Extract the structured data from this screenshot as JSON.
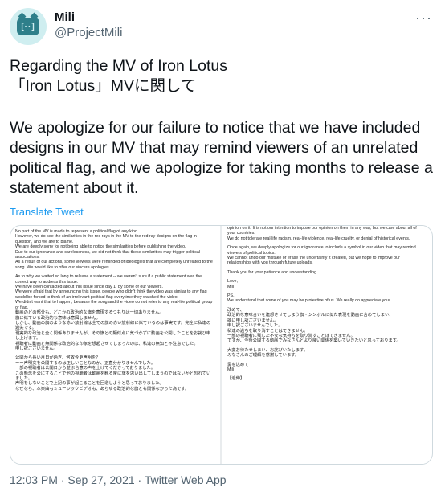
{
  "author": {
    "display_name": "Mili",
    "handle": "@ProjectMili"
  },
  "tweet": {
    "line1": "Regarding the MV of Iron Lotus",
    "line2": "「Iron Lotus」MVに関して",
    "line3": "We apologize for our failure to notice that we have included designs in our MV that may remind viewers of an unrelated political flag, and we apologize for taking months to release a statement about it.",
    "translate": "Translate Tweet",
    "timestamp": "12:03 PM · Sep 27, 2021 · Twitter Web App"
  },
  "attachment": {
    "left": [
      "No part of the MV is made to represent a political flag of any kind.\nHowever, we do see the similarities in the red rays in the MV to the red ray designs on the flag in question, and we are to blame.\nWe are deeply sorry for not being able to notice the similarities before publishing the video.\nDue to our ignorance and carelessness, we did not think that these similarities may trigger political associations.\nAs a result of our actions, some viewers were reminded of ideologies that are completely unrelated to the song. We would like to offer our sincere apologies.",
      "As to why we waited so long to release a statement -- we weren't sure if a public statement was the correct way to address this issue.\nWe have been contacted about this issue since day 1, by some of our viewers.\nWe were afraid that by announcing this issue, people who didn't think the video was similar to any flag would be forced to think of an irrelevant political flag everytime they watched the video.\nWe didn't want that to happen, because the song and the video do not refer to any real-life political group or flag.\n動画のどの部分も、どこかの政治的な旗を表現するつもりは一切ありません。\n旗に似ている政治的な意味は意図しません。\nしかし、動画の旗のような赤い放射線は全ての旗の赤い放射線に似ているのは事実です。完全に私達の過失です。\n現実的な政治と全く関係ありませんが、その旗との類似点に気づかずに動画を公開したことをお詫び申し上げます。\n視聴者に動画と無関係な政治的な印象を想起させてしまったのは、私達の無知と不注意でした。\n申し訳ございません。",
      "公開から長い月日が過ぎ、何故今更声明を？\nーー声明文を公開するのは正しいことなのか、正直分かりませんでした。\n一部の視聴者は公開日から並ぶ合意の声を上げてくださっておりました。\nこの懸念を公にすることで他の視聴者は動画を観る度に旗を思い出してしまうのではないかと恐れていました。\n声明をしないことで上記の事が起こることを回避しようと思っておりました。\nなぜなら、本楽曲もミュージックビデオも、あらゆる政治的な旗とも関係なかった為です。"
    ],
    "right": [
      "opinion on it. It is not our intention to impose our opinion on them in any way, but we care about all of your countries.\nWe do not tolerate real-life racism, real-life violence, real-life cruelty, or denial of historical events.",
      "Once again, we deeply apologize for our ignorance to include a symbol in our video that may remind viewers of political topics.\nWe cannot undo our mistake or erase the uncertainty it created, but we hope to improve our relationships with you through future uploads.",
      "Thank you for your patience and understanding.",
      "Love,\nMili",
      "PS.\nWe understand that some of you may be protective of us. We really do appreciate your",
      "改めて、\n政治的な意味合いを連想させてしまう旗・シンボルに似た表現を動画に含めてしまい、\n誠に申し訳ございません。\n申し訳ございませんでした。\n私達の過ちを取り消すことはできません。\n一部の視聴者に残した不安な気持ちを取り消すことはできません。\nですが、今後公開する動画でみなさんとより良い関係を築いていきたいと思っております。",
      "大変お待たせしまい、お詫びいたします。\nみなさんのご理解を感謝しています。",
      "愛を込めて\nMili",
      "【追伸】"
    ]
  },
  "icons": {
    "more": "more-options-icon",
    "avatar": "mili-logo-avatar"
  },
  "colors": {
    "link": "#1d9bf0",
    "muted": "#536471",
    "text": "#0f1419",
    "border": "#cfd9de"
  }
}
